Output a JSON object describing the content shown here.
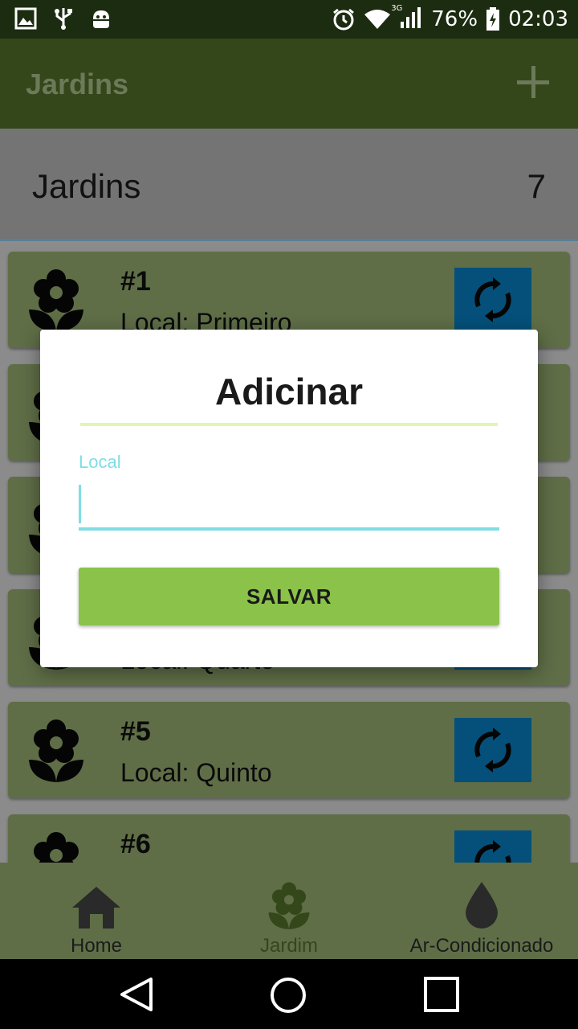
{
  "status_bar": {
    "battery": "76%",
    "time": "02:03",
    "network": "3G",
    "left_icons": [
      "image-icon",
      "usb-icon",
      "android-debug-icon"
    ],
    "right_icons": [
      "alarm-icon",
      "wifi-icon",
      "signal-icon",
      "battery-icon"
    ]
  },
  "app_bar": {
    "title": "Jardins",
    "add_icon": "plus-icon"
  },
  "header": {
    "title": "Jardins",
    "count": "7"
  },
  "gardens": [
    {
      "number": "#1",
      "local": "Local: Primeiro"
    },
    {
      "number": "",
      "local": ""
    },
    {
      "number": "",
      "local": ""
    },
    {
      "number": "",
      "local": "Local: Quarto"
    },
    {
      "number": "#5",
      "local": "Local: Quinto"
    },
    {
      "number": "#6",
      "local": ""
    }
  ],
  "dialog": {
    "title": "Adicinar",
    "field_label": "Local",
    "field_value": "",
    "save_label": "SALVAR"
  },
  "bottom_nav": {
    "items": [
      {
        "label": "Home",
        "icon": "home-icon"
      },
      {
        "label": "Jardim",
        "icon": "flower-icon"
      },
      {
        "label": "Ar-Condicionado",
        "icon": "drop-icon"
      }
    ],
    "active": "Jardim"
  },
  "colors": {
    "app_bar": "#34471a",
    "card": "#5f6e47",
    "sync_button": "#04507a",
    "accent": "#7fdde6",
    "save_button": "#8bc34a",
    "divider": "#e4f5b0"
  }
}
